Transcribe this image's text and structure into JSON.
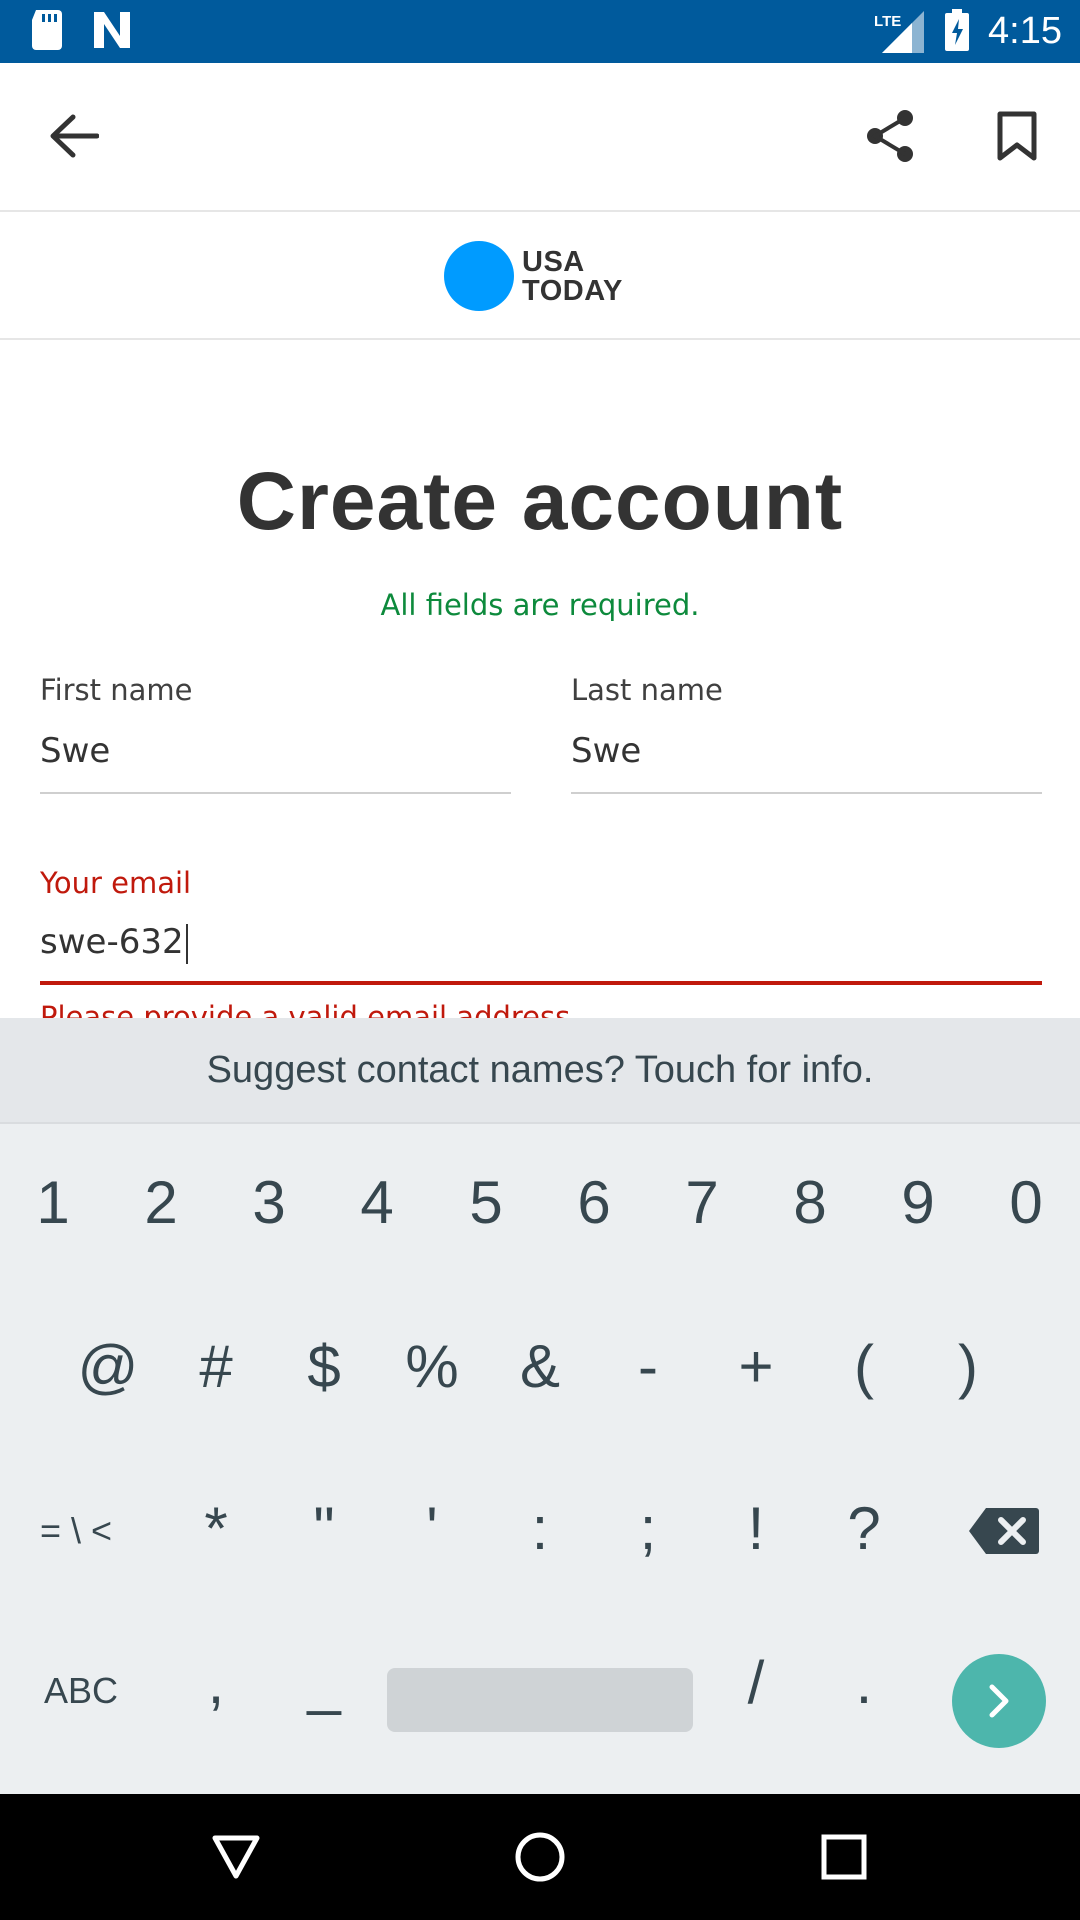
{
  "status_bar": {
    "time": "4:15",
    "network": "LTE",
    "icons": [
      "sd-card-icon",
      "notification-n-icon",
      "signal-icon",
      "battery-charging-icon"
    ]
  },
  "app_bar": {
    "icons": [
      "back-arrow-icon",
      "share-icon",
      "bookmark-icon"
    ]
  },
  "logo": {
    "line1": "USA",
    "line2": "TODAY",
    "dot_color": "#009bff"
  },
  "form": {
    "title": "Create account",
    "required_note": "All fields are required.",
    "first_name": {
      "label": "First name",
      "value": "Swe"
    },
    "last_name": {
      "label": "Last name",
      "value": "Swe"
    },
    "email": {
      "label": "Your email",
      "value": "swe-632",
      "error": "Please provide a valid email address."
    }
  },
  "colors": {
    "status_bar": "#005a9c",
    "error": "#c0190c",
    "success": "#0d8a3c",
    "enter_key": "#4db6ac"
  },
  "keyboard": {
    "suggestion": "Suggest contact names? Touch for info.",
    "row1": [
      "1",
      "2",
      "3",
      "4",
      "5",
      "6",
      "7",
      "8",
      "9",
      "0"
    ],
    "row2": [
      "@",
      "#",
      "$",
      "%",
      "&",
      "-",
      "+",
      "(",
      ")"
    ],
    "row3": [
      "= \\ <",
      "*",
      "\"",
      "'",
      ":",
      ";",
      "!",
      "?"
    ],
    "row4": [
      "ABC",
      ",",
      "_",
      "/",
      "."
    ],
    "icons": [
      "backspace-icon",
      "enter-arrow-icon"
    ]
  },
  "nav_bar": {
    "icons": [
      "back-triangle-icon",
      "home-circle-icon",
      "recents-square-icon"
    ]
  }
}
